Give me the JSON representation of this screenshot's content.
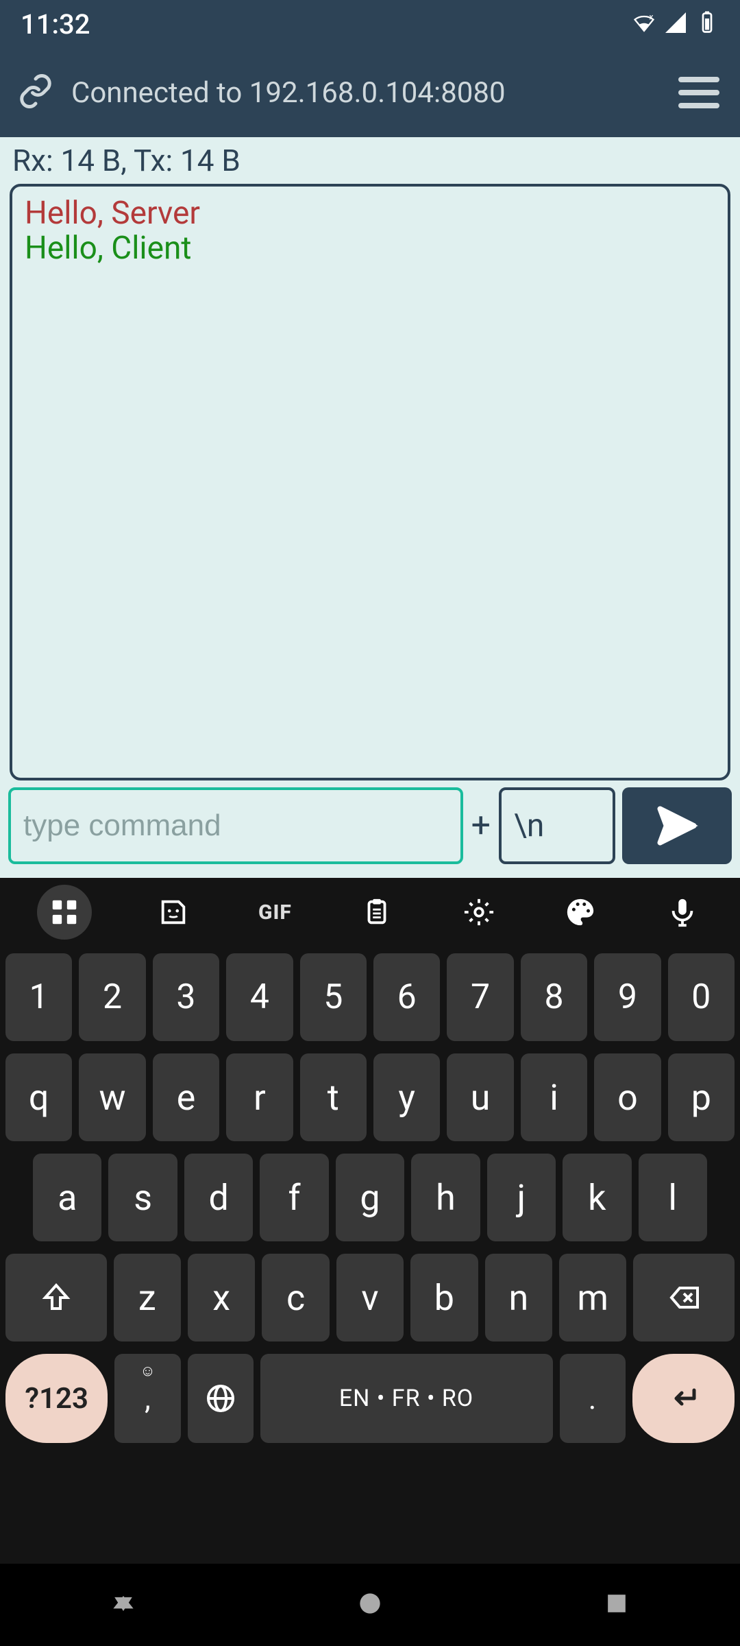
{
  "status": {
    "time": "11:32"
  },
  "header": {
    "title": "Connected to 192.168.0.104:8080"
  },
  "stats": {
    "text": "Rx: 14 B, Tx: 14 B"
  },
  "log": {
    "lines": [
      {
        "text": "Hello, Server",
        "dir": "out"
      },
      {
        "text": "Hello, Client",
        "dir": "in"
      }
    ]
  },
  "input": {
    "placeholder": "type command",
    "value": "",
    "plus": "+",
    "suffix": "\\n"
  },
  "keyboard": {
    "gif_label": "GIF",
    "row_num": [
      "1",
      "2",
      "3",
      "4",
      "5",
      "6",
      "7",
      "8",
      "9",
      "0"
    ],
    "row_q": [
      "q",
      "w",
      "e",
      "r",
      "t",
      "y",
      "u",
      "i",
      "o",
      "p"
    ],
    "row_a": [
      "a",
      "s",
      "d",
      "f",
      "g",
      "h",
      "j",
      "k",
      "l"
    ],
    "row_z": [
      "z",
      "x",
      "c",
      "v",
      "b",
      "n",
      "m"
    ],
    "num_label": "?123",
    "comma": ",",
    "space_label": "EN • FR • RO",
    "dot": "."
  }
}
